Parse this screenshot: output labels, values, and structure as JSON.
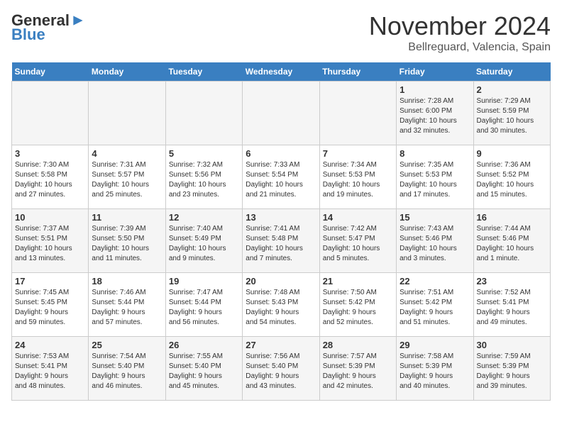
{
  "header": {
    "logo_general": "General",
    "logo_blue": "Blue",
    "month": "November 2024",
    "location": "Bellreguard, Valencia, Spain"
  },
  "weekdays": [
    "Sunday",
    "Monday",
    "Tuesday",
    "Wednesday",
    "Thursday",
    "Friday",
    "Saturday"
  ],
  "weeks": [
    [
      {
        "day": "",
        "info": ""
      },
      {
        "day": "",
        "info": ""
      },
      {
        "day": "",
        "info": ""
      },
      {
        "day": "",
        "info": ""
      },
      {
        "day": "",
        "info": ""
      },
      {
        "day": "1",
        "info": "Sunrise: 7:28 AM\nSunset: 6:00 PM\nDaylight: 10 hours\nand 32 minutes."
      },
      {
        "day": "2",
        "info": "Sunrise: 7:29 AM\nSunset: 5:59 PM\nDaylight: 10 hours\nand 30 minutes."
      }
    ],
    [
      {
        "day": "3",
        "info": "Sunrise: 7:30 AM\nSunset: 5:58 PM\nDaylight: 10 hours\nand 27 minutes."
      },
      {
        "day": "4",
        "info": "Sunrise: 7:31 AM\nSunset: 5:57 PM\nDaylight: 10 hours\nand 25 minutes."
      },
      {
        "day": "5",
        "info": "Sunrise: 7:32 AM\nSunset: 5:56 PM\nDaylight: 10 hours\nand 23 minutes."
      },
      {
        "day": "6",
        "info": "Sunrise: 7:33 AM\nSunset: 5:54 PM\nDaylight: 10 hours\nand 21 minutes."
      },
      {
        "day": "7",
        "info": "Sunrise: 7:34 AM\nSunset: 5:53 PM\nDaylight: 10 hours\nand 19 minutes."
      },
      {
        "day": "8",
        "info": "Sunrise: 7:35 AM\nSunset: 5:53 PM\nDaylight: 10 hours\nand 17 minutes."
      },
      {
        "day": "9",
        "info": "Sunrise: 7:36 AM\nSunset: 5:52 PM\nDaylight: 10 hours\nand 15 minutes."
      }
    ],
    [
      {
        "day": "10",
        "info": "Sunrise: 7:37 AM\nSunset: 5:51 PM\nDaylight: 10 hours\nand 13 minutes."
      },
      {
        "day": "11",
        "info": "Sunrise: 7:39 AM\nSunset: 5:50 PM\nDaylight: 10 hours\nand 11 minutes."
      },
      {
        "day": "12",
        "info": "Sunrise: 7:40 AM\nSunset: 5:49 PM\nDaylight: 10 hours\nand 9 minutes."
      },
      {
        "day": "13",
        "info": "Sunrise: 7:41 AM\nSunset: 5:48 PM\nDaylight: 10 hours\nand 7 minutes."
      },
      {
        "day": "14",
        "info": "Sunrise: 7:42 AM\nSunset: 5:47 PM\nDaylight: 10 hours\nand 5 minutes."
      },
      {
        "day": "15",
        "info": "Sunrise: 7:43 AM\nSunset: 5:46 PM\nDaylight: 10 hours\nand 3 minutes."
      },
      {
        "day": "16",
        "info": "Sunrise: 7:44 AM\nSunset: 5:46 PM\nDaylight: 10 hours\nand 1 minute."
      }
    ],
    [
      {
        "day": "17",
        "info": "Sunrise: 7:45 AM\nSunset: 5:45 PM\nDaylight: 9 hours\nand 59 minutes."
      },
      {
        "day": "18",
        "info": "Sunrise: 7:46 AM\nSunset: 5:44 PM\nDaylight: 9 hours\nand 57 minutes."
      },
      {
        "day": "19",
        "info": "Sunrise: 7:47 AM\nSunset: 5:44 PM\nDaylight: 9 hours\nand 56 minutes."
      },
      {
        "day": "20",
        "info": "Sunrise: 7:48 AM\nSunset: 5:43 PM\nDaylight: 9 hours\nand 54 minutes."
      },
      {
        "day": "21",
        "info": "Sunrise: 7:50 AM\nSunset: 5:42 PM\nDaylight: 9 hours\nand 52 minutes."
      },
      {
        "day": "22",
        "info": "Sunrise: 7:51 AM\nSunset: 5:42 PM\nDaylight: 9 hours\nand 51 minutes."
      },
      {
        "day": "23",
        "info": "Sunrise: 7:52 AM\nSunset: 5:41 PM\nDaylight: 9 hours\nand 49 minutes."
      }
    ],
    [
      {
        "day": "24",
        "info": "Sunrise: 7:53 AM\nSunset: 5:41 PM\nDaylight: 9 hours\nand 48 minutes."
      },
      {
        "day": "25",
        "info": "Sunrise: 7:54 AM\nSunset: 5:40 PM\nDaylight: 9 hours\nand 46 minutes."
      },
      {
        "day": "26",
        "info": "Sunrise: 7:55 AM\nSunset: 5:40 PM\nDaylight: 9 hours\nand 45 minutes."
      },
      {
        "day": "27",
        "info": "Sunrise: 7:56 AM\nSunset: 5:40 PM\nDaylight: 9 hours\nand 43 minutes."
      },
      {
        "day": "28",
        "info": "Sunrise: 7:57 AM\nSunset: 5:39 PM\nDaylight: 9 hours\nand 42 minutes."
      },
      {
        "day": "29",
        "info": "Sunrise: 7:58 AM\nSunset: 5:39 PM\nDaylight: 9 hours\nand 40 minutes."
      },
      {
        "day": "30",
        "info": "Sunrise: 7:59 AM\nSunset: 5:39 PM\nDaylight: 9 hours\nand 39 minutes."
      }
    ]
  ]
}
